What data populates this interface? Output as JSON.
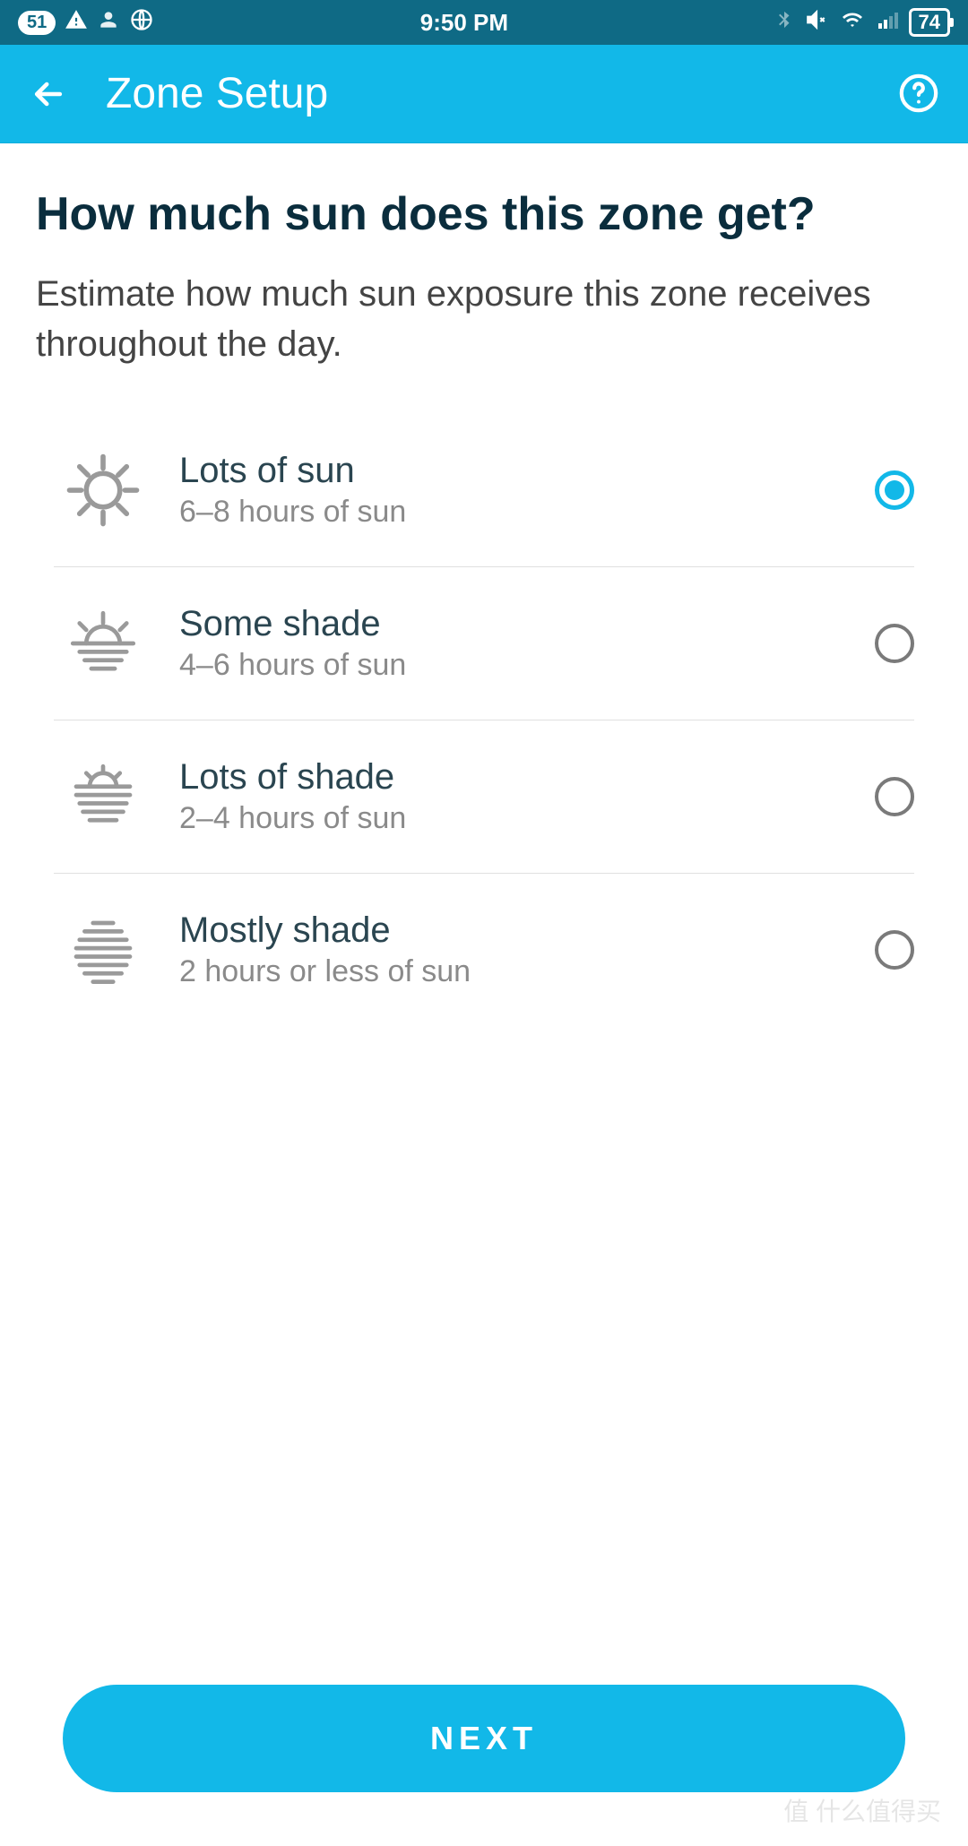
{
  "status": {
    "notif_count": "51",
    "time": "9:50 PM",
    "battery": "74"
  },
  "header": {
    "title": "Zone Setup"
  },
  "main": {
    "question": "How much sun does this zone get?",
    "subtext": "Estimate how much sun exposure this zone receives throughout the day.",
    "options": [
      {
        "title": "Lots of sun",
        "sub": "6–8 hours of sun",
        "selected": true
      },
      {
        "title": "Some shade",
        "sub": "4–6 hours of sun",
        "selected": false
      },
      {
        "title": "Lots of shade",
        "sub": "2–4 hours of sun",
        "selected": false
      },
      {
        "title": "Mostly shade",
        "sub": "2 hours or less of sun",
        "selected": false
      }
    ]
  },
  "footer": {
    "next_label": "NEXT"
  },
  "watermark": "值 什么值得买"
}
